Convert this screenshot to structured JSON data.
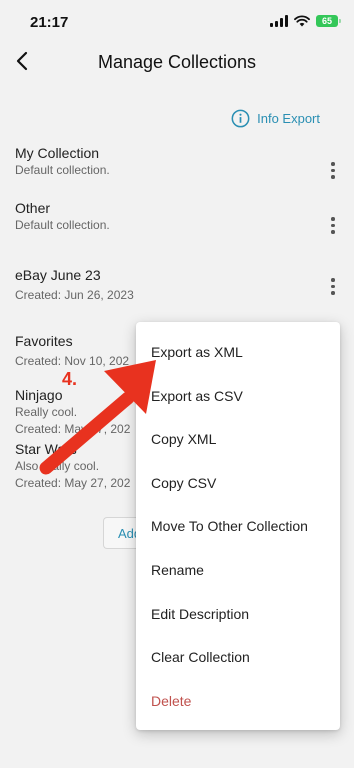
{
  "status_bar": {
    "time": "21:17",
    "battery": "65"
  },
  "header": {
    "title": "Manage Collections"
  },
  "info_export": {
    "label": "Info Export"
  },
  "collections": [
    {
      "name": "My Collection",
      "description": "Default collection."
    },
    {
      "name": "Other",
      "description": "Default collection."
    },
    {
      "name": "eBay June 23",
      "description": "Created: Jun 26, 2023"
    },
    {
      "name": "Favorites",
      "description": "Created: Nov 10, 202"
    },
    {
      "name": "Ninjago",
      "description": "Really cool.",
      "description2": "Created: May 27, 202"
    },
    {
      "name": "Star Wars",
      "description": "Also really cool.",
      "description2": "Created: May 27, 202"
    }
  ],
  "add_button": {
    "label": "Add"
  },
  "context_menu": {
    "items": [
      "Export as XML",
      "Export as CSV",
      "Copy XML",
      "Copy CSV",
      "Move To Other Collection",
      "Rename",
      "Edit Description",
      "Clear Collection",
      "Delete"
    ]
  },
  "annotation": {
    "step_label": "4.",
    "color": "#e8321f"
  },
  "colors": {
    "accent": "#2a8fb3",
    "danger": "#c0514d",
    "background": "#f2f2f2"
  }
}
